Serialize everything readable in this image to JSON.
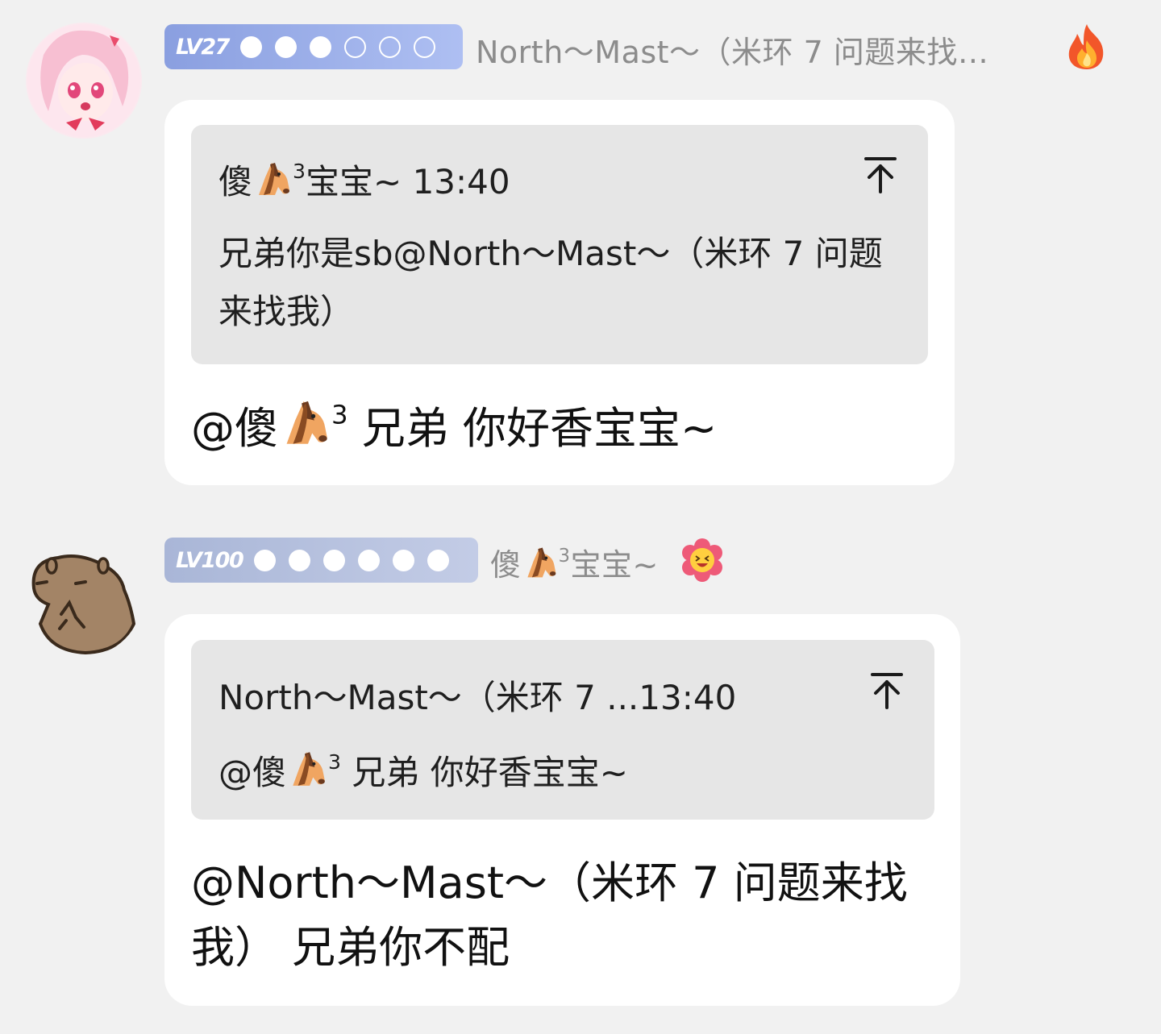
{
  "messages": [
    {
      "level": "LV27",
      "level_dots_filled": 3,
      "level_dots_total": 6,
      "badge_color_start": "#8a9fe0",
      "badge_color_end": "#aebff2",
      "sender": "North～Mast～（米环 7 问题来找…",
      "sender_badge_icon": "fire-icon",
      "quote": {
        "author_prefix": "傻",
        "author_sup": "3",
        "author_suffix": "宝宝~ 13:40",
        "text": "兄弟你是sb@North～Mast～（米环 7 问题来找我）"
      },
      "body_prefix": "@傻",
      "body_sup": "3",
      "body_suffix": " 兄弟 你好香宝宝~"
    },
    {
      "level": "LV100",
      "level_dots_filled": 6,
      "level_dots_total": 6,
      "badge_color_start": "#a9b6d7",
      "badge_color_end": "#c3cce6",
      "sender_prefix": "傻",
      "sender_sup": "3",
      "sender_suffix": "宝宝~",
      "sender_badge_icon": "flower-laughing-icon",
      "quote": {
        "meta": "North～Mast～（米环 7 ...13:40",
        "text_prefix": "@傻",
        "text_sup": "3",
        "text_suffix": " 兄弟 你好香宝宝~"
      },
      "body": "@North～Mast～（米环 7 问题来找我） 兄弟你不配"
    }
  ]
}
